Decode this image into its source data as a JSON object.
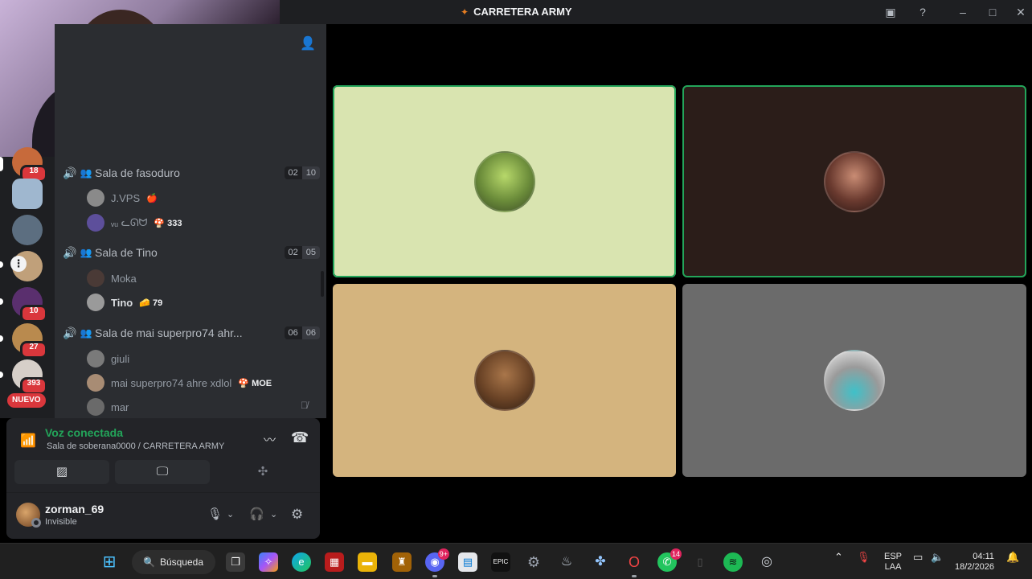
{
  "window": {
    "title": "CARRETERA ARMY",
    "title_glyph": "✦"
  },
  "servers": [
    {
      "badge": "18"
    },
    {
      "badge": ""
    },
    {
      "badge": ""
    },
    {
      "badge": ""
    },
    {
      "badge": "10"
    },
    {
      "badge": "27"
    },
    {
      "badge": "393"
    }
  ],
  "servers_new_label": "NUEVO",
  "voice_channels": [
    {
      "name": "Sala de fasoduro",
      "count_current": "02",
      "count_limit": "10",
      "users": [
        {
          "name": "J.VPS",
          "tag": "🍎"
        },
        {
          "name": "ᵥᵤ ᓚᘏᗢ",
          "tag": "🍄 333"
        }
      ]
    },
    {
      "name": "Sala de Tino",
      "count_current": "02",
      "count_limit": "05",
      "users": [
        {
          "name": "Moka",
          "tag": ""
        },
        {
          "name": "Tino",
          "tag": "🧀 79"
        }
      ]
    },
    {
      "name": "Sala de mai superpro74 ahr...",
      "count_current": "06",
      "count_limit": "06",
      "users": [
        {
          "name": "giuli",
          "tag": ""
        },
        {
          "name": "mai superpro74 ahre xdlol",
          "tag": "🍄 MOE"
        },
        {
          "name": "mar",
          "tag": ""
        }
      ]
    }
  ],
  "voice_panel": {
    "status": "Voz conectada",
    "location": "Sala de soberana0000 / CARRETERA ARMY"
  },
  "user": {
    "name": "zorman_69",
    "status": "Invisible"
  },
  "taskbar": {
    "search_label": "Búsqueda",
    "discord_badge": "9+",
    "whatsapp_badge": "14",
    "lang_top": "ESP",
    "lang_bottom": "LAA",
    "time": "04:11",
    "date": "18/2/2026"
  },
  "colors": {
    "tile1": "#d9e4b0",
    "tile2": "#2b1d19",
    "tile3": "#d4b47e",
    "tile4": "#6b6b6b",
    "speaking": "#23a55a"
  }
}
